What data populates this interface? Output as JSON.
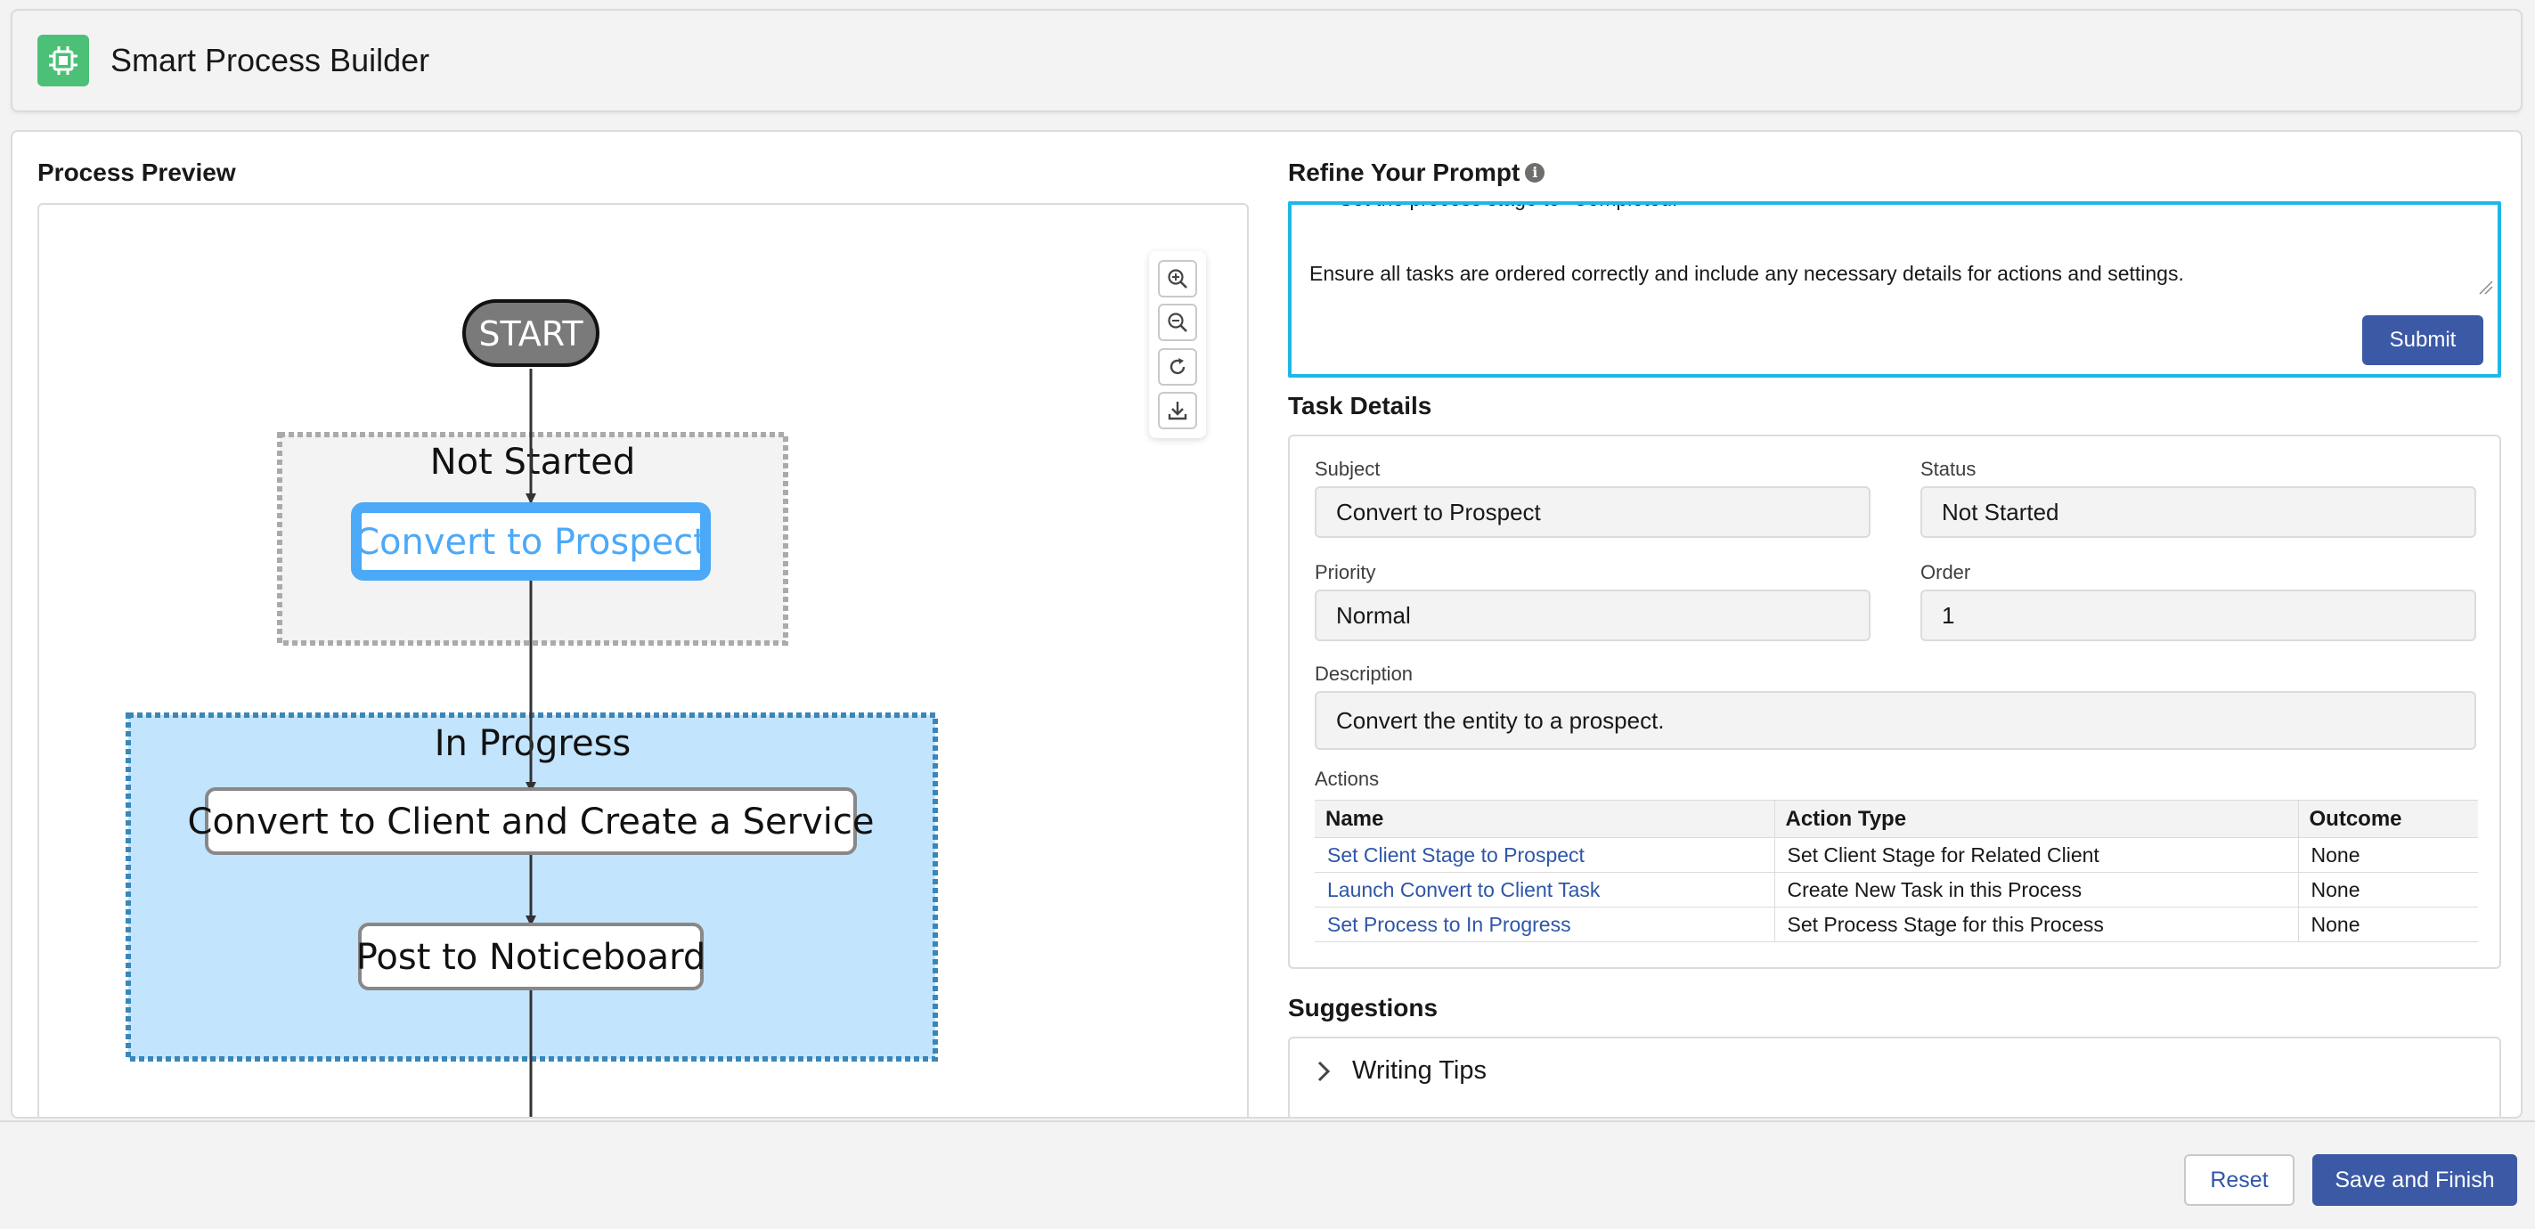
{
  "header": {
    "title": "Smart Process Builder",
    "logo_icon": "chip-icon"
  },
  "preview": {
    "title": "Process Preview",
    "toolbar": [
      "zoom-in-icon",
      "zoom-out-icon",
      "refresh-icon",
      "download-icon"
    ],
    "flow": {
      "start": "START",
      "stages": [
        {
          "label": "Not Started",
          "tasks": [
            "Convert to Prospect"
          ]
        },
        {
          "label": "In Progress",
          "tasks": [
            "Convert to Client and Create a Service",
            "Post to Noticeboard"
          ]
        }
      ]
    }
  },
  "prompt": {
    "title": "Refine Your Prompt",
    "info_icon": "info-icon",
    "text": "   - Set the process stage to \"Completed.\"\n\nEnsure all tasks are ordered correctly and include any necessary details for actions and settings.",
    "submit_label": "Submit"
  },
  "task_details": {
    "title": "Task Details",
    "subject_label": "Subject",
    "subject_value": "Convert to Prospect",
    "status_label": "Status",
    "status_value": "Not Started",
    "priority_label": "Priority",
    "priority_value": "Normal",
    "order_label": "Order",
    "order_value": "1",
    "description_label": "Description",
    "description_value": "Convert the entity to a prospect.",
    "actions_label": "Actions",
    "columns": [
      "Name",
      "Action Type",
      "Outcome"
    ],
    "rows": [
      {
        "name": "Set Client Stage to Prospect",
        "type": "Set Client Stage for Related Client",
        "outcome": "None"
      },
      {
        "name": "Launch Convert to Client Task",
        "type": "Create New Task in this Process",
        "outcome": "None"
      },
      {
        "name": "Set Process to In Progress",
        "type": "Set Process Stage for this Process",
        "outcome": "None"
      }
    ]
  },
  "suggestions": {
    "title": "Suggestions",
    "items": [
      "Writing Tips"
    ]
  },
  "footer": {
    "reset_label": "Reset",
    "save_label": "Save and Finish"
  },
  "colors": {
    "accent": "#3b59a5",
    "focus": "#1fb7e8",
    "logo": "#4bc076",
    "selected_node": "#4ca9f8",
    "in_progress_fill": "#c2e4fc"
  }
}
